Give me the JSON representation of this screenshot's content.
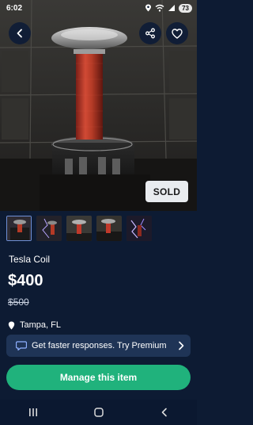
{
  "status_bar": {
    "time": "6:02",
    "battery": "73"
  },
  "listing": {
    "sold_label": "SOLD",
    "title": "Tesla Coil",
    "price": "$400",
    "original_price": "$500",
    "location": "Tampa, FL"
  },
  "thumbnails": [
    {
      "name": "photo-1"
    },
    {
      "name": "photo-2"
    },
    {
      "name": "photo-3"
    },
    {
      "name": "photo-4"
    },
    {
      "name": "photo-5"
    }
  ],
  "premium_banner": {
    "label": "Get faster responses. Try Premium"
  },
  "actions": {
    "manage_label": "Manage this item"
  },
  "colors": {
    "background": "#0d1b33",
    "accent_green": "#20b27c",
    "banner": "#1f3456",
    "coil_copper": "#c0392b"
  },
  "icons": [
    "back-arrow-icon",
    "share-icon",
    "heart-icon",
    "chat-bubble-icon",
    "chevron-right-icon",
    "location-pin-icon",
    "recent-apps-icon",
    "home-icon",
    "back-nav-icon"
  ]
}
